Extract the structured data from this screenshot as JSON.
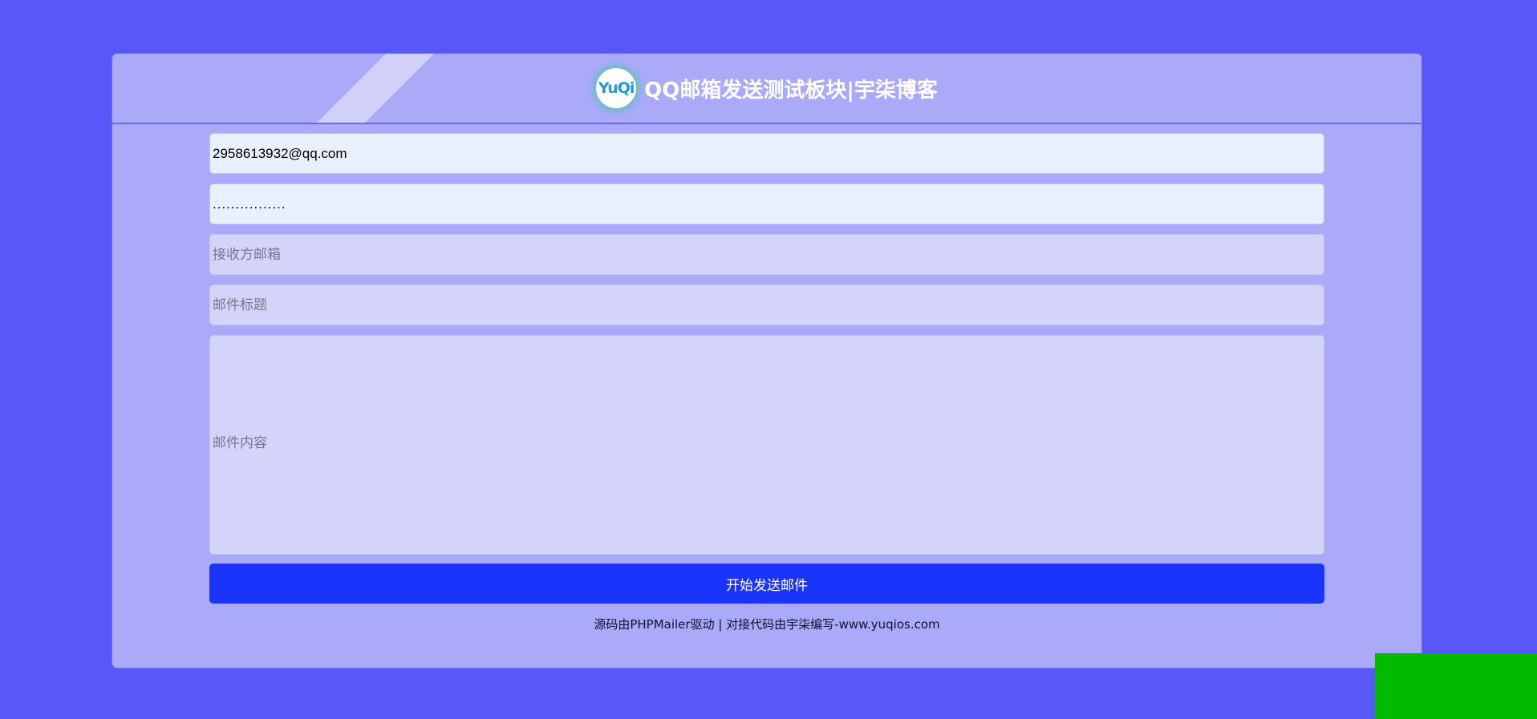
{
  "header": {
    "logo_text": "YuQi",
    "title": "QQ邮箱发送测试板块|宇柒博客"
  },
  "form": {
    "sender_email": {
      "value": "2958613932@qq.com"
    },
    "auth_code": {
      "value": "................"
    },
    "recipient": {
      "placeholder": "接收方邮箱"
    },
    "subject": {
      "placeholder": "邮件标题"
    },
    "content": {
      "placeholder": "邮件内容"
    },
    "send_label": "开始发送邮件"
  },
  "footer": {
    "text": "源码由PHPMailer驱动 | 对接代码由宇柒编写-www.yuqios.com"
  },
  "colors": {
    "background": "#5858f8",
    "card": "#aaaaf8",
    "button": "#1b34fb",
    "corner_block": "#00bb00"
  }
}
